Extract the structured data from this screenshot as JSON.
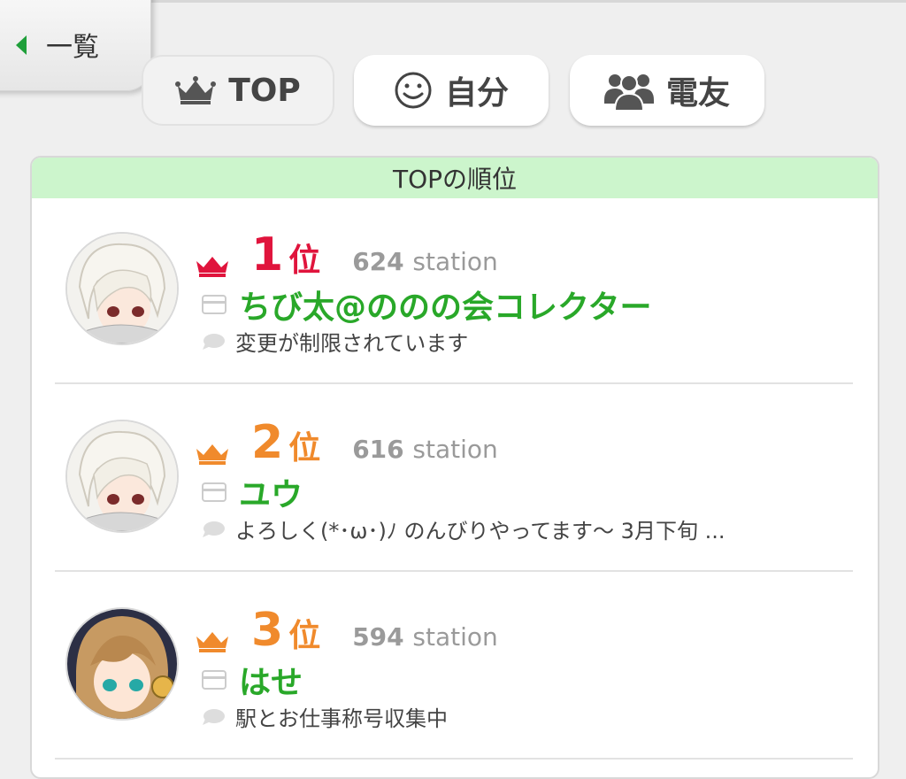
{
  "back": {
    "label": "一覧"
  },
  "tabs": [
    {
      "label": "TOP",
      "icon": "crown-icon",
      "active": true
    },
    {
      "label": "自分",
      "icon": "smiley-icon",
      "active": false
    },
    {
      "label": "電友",
      "icon": "group-icon",
      "active": false
    }
  ],
  "ranking": {
    "title": "TOPの順位",
    "station_unit": "station",
    "entries": [
      {
        "rank": "1",
        "suffix": "位",
        "stations": "624",
        "name": "ちび太@ののの会コレクター",
        "comment": "変更が制限されています",
        "rank_color": "#e0143c"
      },
      {
        "rank": "2",
        "suffix": "位",
        "stations": "616",
        "name": "ユウ",
        "comment": "よろしく(*･ω･)ﾉ のんびりやってます～ 3月下旬 ...",
        "rank_color": "#f08a2c"
      },
      {
        "rank": "3",
        "suffix": "位",
        "stations": "594",
        "name": "はせ",
        "comment": "駅とお仕事称号収集中",
        "rank_color": "#f08a2c"
      }
    ]
  },
  "colors": {
    "accent_green": "#29a829",
    "header_green": "#ccf5cc"
  }
}
